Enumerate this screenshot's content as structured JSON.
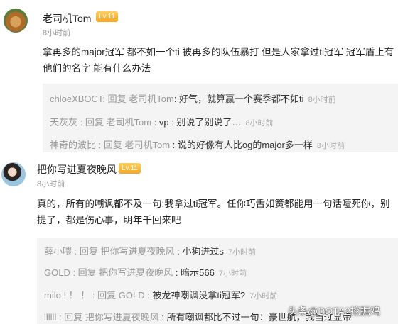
{
  "comments": [
    {
      "username": "老司机Tom",
      "level": "Lv.11",
      "time": "8小时前",
      "text": "拿再多的major冠军 都不如一个ti 被再多的队伍暴打 但是人家拿过ti冠军 冠军盾上有他们的名字 能有什么办法",
      "replies": [
        {
          "author": "chloeXBOCT",
          "prefix": ": 回复 ",
          "target": "老司机Tom",
          "content": ": 好气，就算赢一个赛季都不如ti",
          "time": "8小时前"
        },
        {
          "author": "天灰灰",
          "prefix": " : 回复 ",
          "target": "老司机Tom",
          "content": " : vp : 别说了别说了…",
          "time": "8小时前"
        },
        {
          "author": "神奇的波比",
          "prefix": " : 回复 ",
          "target": "老司机Tom",
          "content": " : 说的好像有人比og的major多一样",
          "time": "8小时前"
        }
      ]
    },
    {
      "username": "把你写进夏夜晚风",
      "level": "Lv.11",
      "time": "8小时前",
      "text": "真的，所有的嘲讽都不及一句:我拿过ti冠军。任你巧舌如簧都能用一句话噎死你，别提了，都是伤心事，明年千回来吧",
      "replies": [
        {
          "author": "薛小喂",
          "prefix": " : 回复 ",
          "target": "把你写进夏夜晚风",
          "content": " : 小狗进过s",
          "time": "7小时前"
        },
        {
          "author": "GOLD",
          "prefix": " : 回复 ",
          "target": "把你写进夏夜晚风",
          "content": " : 暗示566",
          "time": "7小时前"
        },
        {
          "author": "milo ! ！ ！",
          "prefix": " : 回复 ",
          "target": "GOLD",
          "content": " : 被龙神嘲讽没拿ti冠军?",
          "time": "7小时前"
        },
        {
          "author": "llllll",
          "prefix": " : 回复 ",
          "target": "把你写进夏夜晚风",
          "content": " : 所有嘲讽都比不过一句：豪世航，我当过显帝",
          "time": ""
        }
      ]
    }
  ],
  "watermark": "头条@DOTA2挖掘鸡"
}
